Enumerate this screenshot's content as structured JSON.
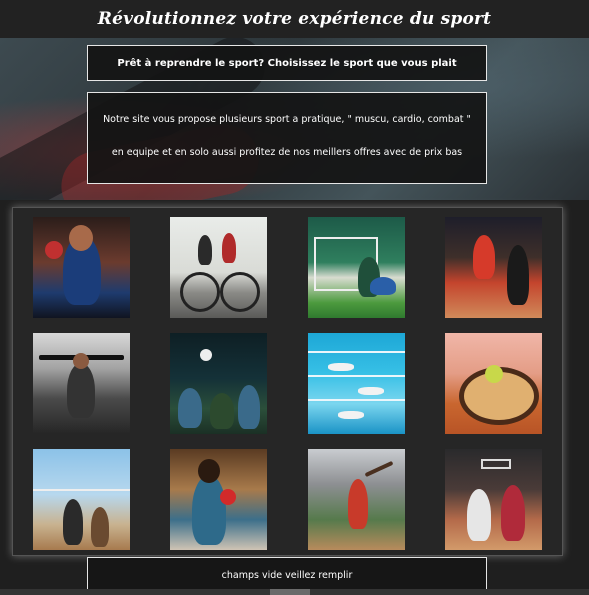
{
  "header": {
    "title": "Révolutionnez votre expérience du sport"
  },
  "hero": {
    "prompt": "Prêt à reprendre le sport? Choisissez le sport que vous plait",
    "description": "Notre site vous propose plusieurs sport a pratique, \" muscu, cardio, combat \" en equipe et en solo aussi profitez de nos meillers offres avec de prix bas"
  },
  "gallery": {
    "items": [
      {
        "sport": "boxing"
      },
      {
        "sport": "cycling"
      },
      {
        "sport": "soccer"
      },
      {
        "sport": "handball"
      },
      {
        "sport": "weightlifting"
      },
      {
        "sport": "rugby"
      },
      {
        "sport": "swimming"
      },
      {
        "sport": "tennis"
      },
      {
        "sport": "volleyball"
      },
      {
        "sport": "table-tennis"
      },
      {
        "sport": "baseball"
      },
      {
        "sport": "basketball"
      }
    ]
  },
  "form": {
    "message": "champs vide veillez remplir"
  }
}
